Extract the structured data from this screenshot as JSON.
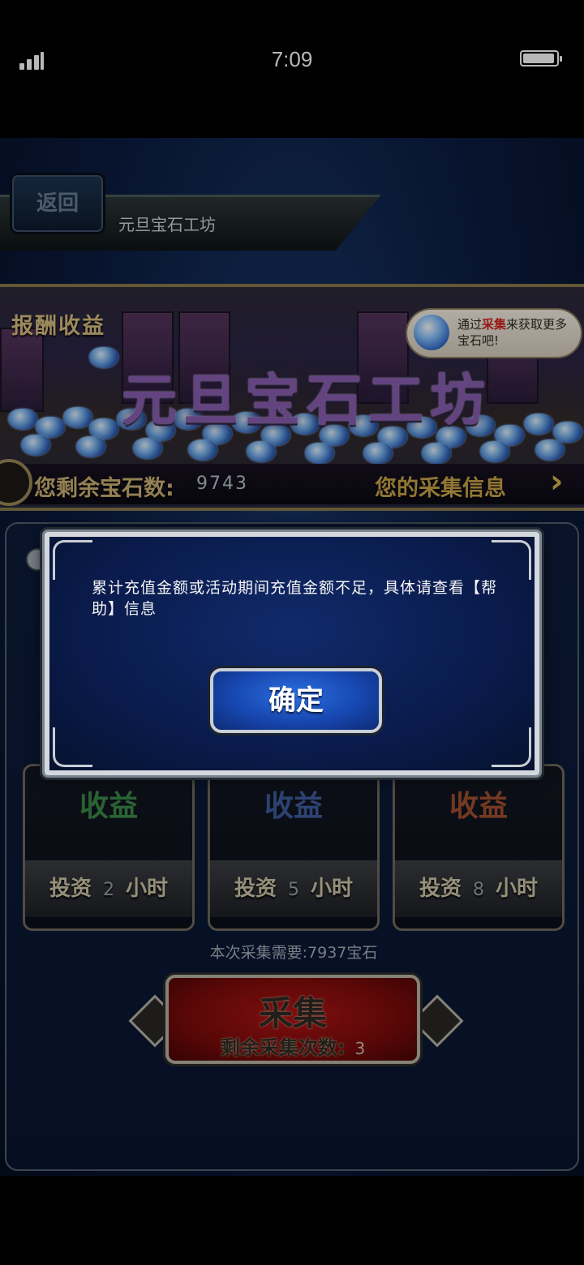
{
  "status_bar": {
    "time": "7:09"
  },
  "header": {
    "back_label": "返回",
    "title": "元旦宝石工坊"
  },
  "banner": {
    "reward_label": "报酬收益",
    "title": "元旦宝石工坊",
    "tip_prefix": "通过",
    "tip_highlight": "采集",
    "tip_suffix": "来获取更多宝石吧!",
    "remaining_label": "您剩余宝石数:",
    "remaining_value": "9743",
    "collect_info_label": "您的采集信息"
  },
  "cards": [
    {
      "title": "收益",
      "invest_label": "投资",
      "hours": "2",
      "unit": "小时",
      "title_color": "#3b8a47"
    },
    {
      "title": "收益",
      "invest_label": "投资",
      "hours": "5",
      "unit": "小时",
      "title_color": "#3d5d9e"
    },
    {
      "title": "收益",
      "invest_label": "投资",
      "hours": "8",
      "unit": "小时",
      "title_color": "#a2502e"
    }
  ],
  "collection": {
    "need_text": "本次采集需要:7937宝石",
    "button_label": "采集",
    "remaining_label": "剩余采集次数:",
    "remaining_count": "3"
  },
  "dialog": {
    "message": "累计充值金额或活动期间充值金额不足，具体请查看【帮助】信息",
    "confirm_label": "确定"
  }
}
